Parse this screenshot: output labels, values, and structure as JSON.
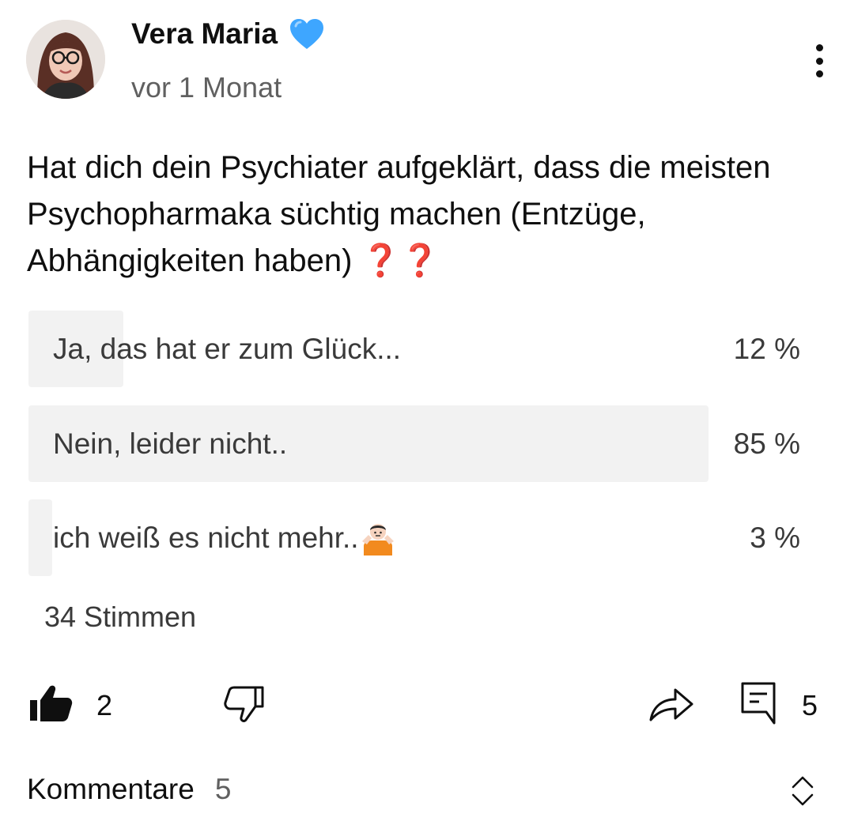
{
  "post": {
    "author": "Vera Maria",
    "timestamp": "vor 1 Monat",
    "text": "Hat dich dein Psychiater aufgeklärt, dass die meisten Psychopharmaka süchtig machen (Entzüge, Abhängigkeiten haben)",
    "text_emoji": "❓❓"
  },
  "poll": {
    "options": [
      {
        "label": "Ja, das hat er zum Glück...",
        "percent_label": "12 %",
        "fraction": 0.12
      },
      {
        "label": "Nein, leider nicht..",
        "percent_label": "85 %",
        "fraction": 0.86
      },
      {
        "label": "ich weiß es nicht mehr..",
        "percent_label": "3 %",
        "fraction": 0.03
      }
    ],
    "votes": "34 Stimmen"
  },
  "actions": {
    "likes": "2",
    "comments": "5"
  },
  "comments_section": {
    "label": "Kommentare",
    "count": "5"
  },
  "icons": {
    "verified_heart": "blue-heart-icon",
    "menu": "more-vertical-icon",
    "like": "thumbs-up-icon",
    "dislike": "thumbs-down-icon",
    "share": "share-arrow-icon",
    "comment": "comment-icon",
    "expand": "expand-collapse-icon",
    "shrug": "person-shrugging-emoji"
  },
  "colors": {
    "heart": "#3ea6ff",
    "question_mark": "#d2232a",
    "poll_fill": "#f2f2f2"
  }
}
